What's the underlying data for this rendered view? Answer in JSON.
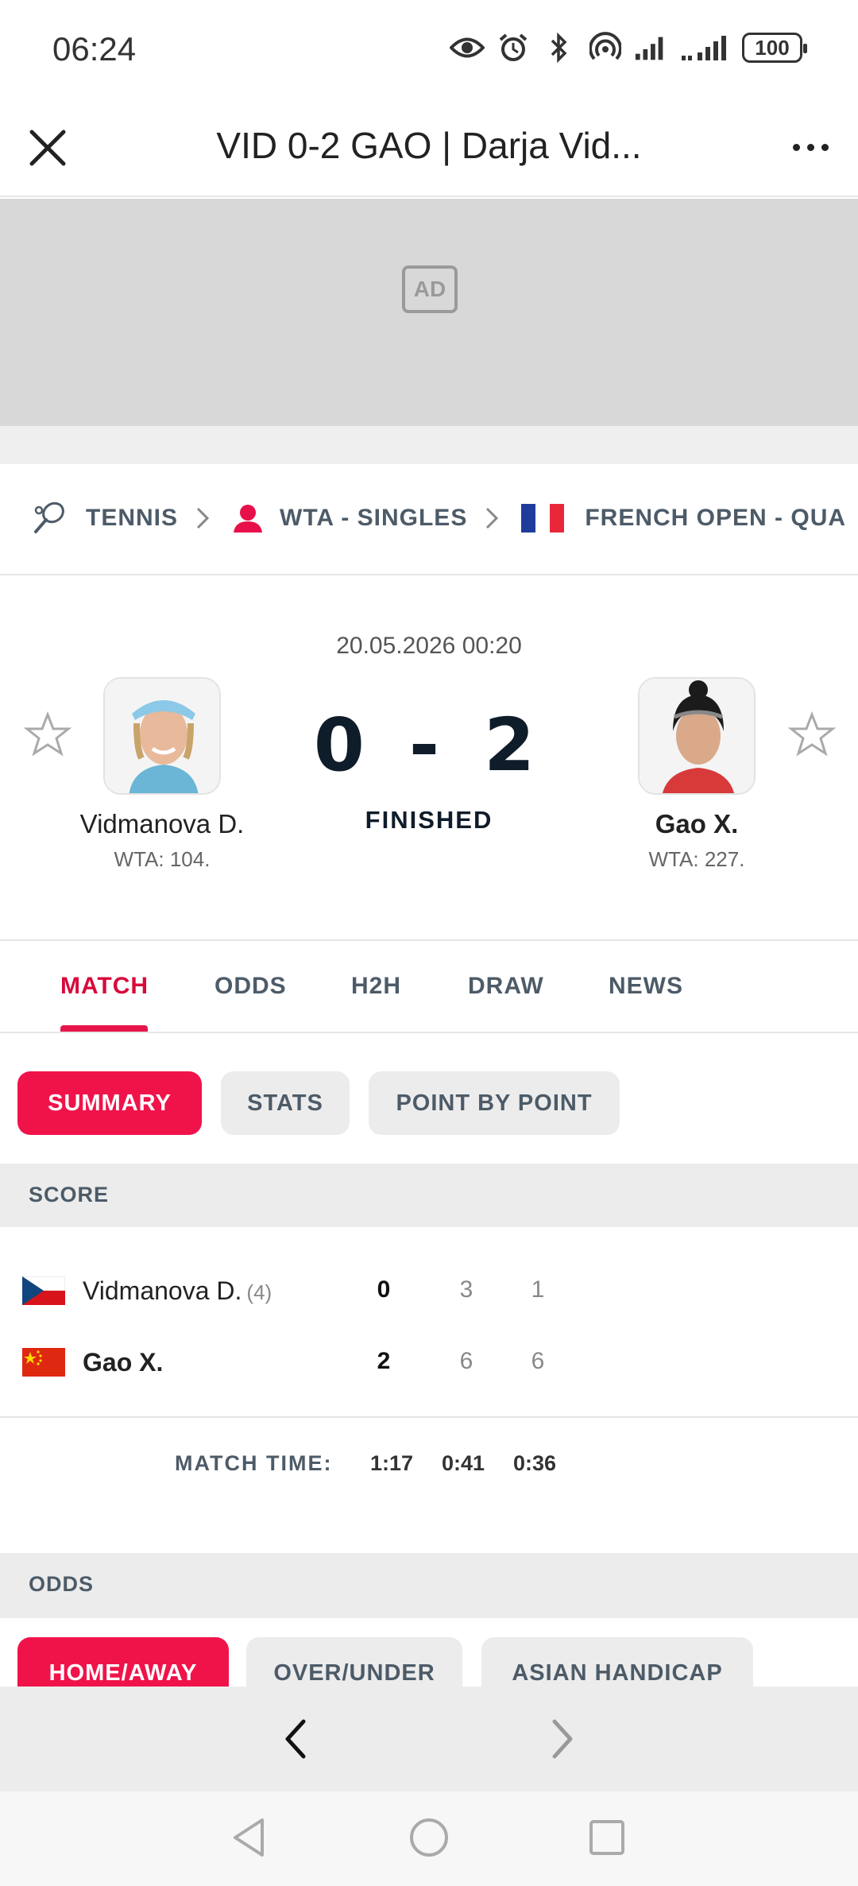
{
  "status_bar": {
    "time": "06:24",
    "battery": "100"
  },
  "header": {
    "title": "VID 0-2 GAO | Darja Vid..."
  },
  "ad": {
    "label": "AD"
  },
  "breadcrumb": {
    "sport": "TENNIS",
    "category": "WTA - SINGLES",
    "tournament": "FRENCH OPEN - QUA"
  },
  "match": {
    "datetime": "20.05.2026 00:20",
    "score": "0 - 2",
    "status": "FINISHED",
    "home": {
      "name": "Vidmanova D.",
      "rank": "WTA: 104."
    },
    "away": {
      "name": "Gao X.",
      "rank": "WTA: 227."
    }
  },
  "tabs": [
    "MATCH",
    "ODDS",
    "H2H",
    "DRAW",
    "NEWS"
  ],
  "subtabs": [
    "SUMMARY",
    "STATS",
    "POINT BY POINT"
  ],
  "score_section": {
    "title": "SCORE",
    "rows": [
      {
        "name": "Vidmanova D.",
        "seed": "(4)",
        "sets": "0",
        "set1": "3",
        "set2": "1"
      },
      {
        "name": "Gao X.",
        "seed": "",
        "sets": "2",
        "set1": "6",
        "set2": "6"
      }
    ],
    "match_time_label": "MATCH TIME:",
    "times": [
      "1:17",
      "0:41",
      "0:36"
    ]
  },
  "odds_section": {
    "title": "ODDS",
    "tabs": [
      "HOME/AWAY",
      "OVER/UNDER",
      "ASIAN HANDICAP"
    ]
  },
  "colors": {
    "accent": "#f0134a",
    "text_dark": "#0f1c2a",
    "muted": "#4d5b68"
  }
}
